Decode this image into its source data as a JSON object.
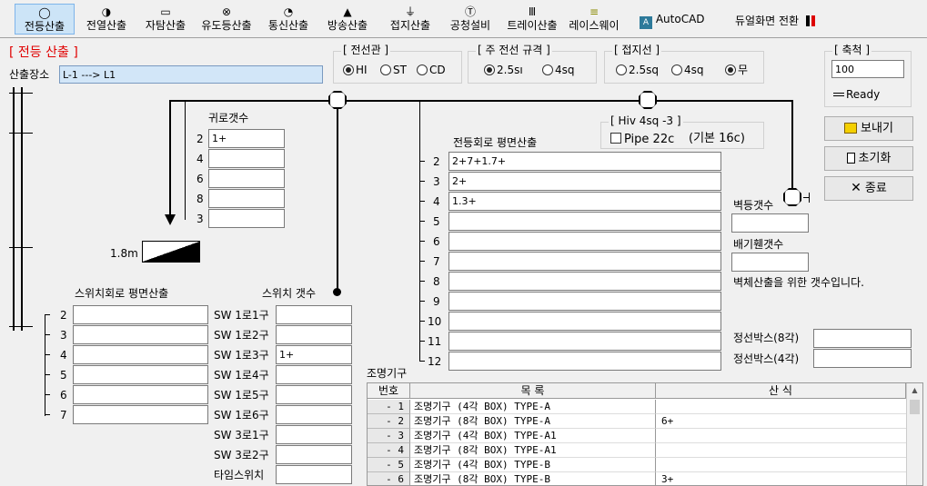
{
  "toolbar": {
    "tabs": [
      {
        "label": "전등산출",
        "icon": "◯"
      },
      {
        "label": "전열산출",
        "icon": "◑"
      },
      {
        "label": "자탐산출",
        "icon": "▭"
      },
      {
        "label": "유도등산출",
        "icon": "⊗"
      },
      {
        "label": "통신산출",
        "icon": "◔"
      },
      {
        "label": "방송산출",
        "icon": "▲"
      },
      {
        "label": "접지산출",
        "icon": "⏚"
      },
      {
        "label": "공청설비",
        "icon": "Ⓣ"
      },
      {
        "label": "트레이산출",
        "icon": "Ⅲ"
      },
      {
        "label": "레이스웨이",
        "icon": "≡"
      }
    ],
    "autocad_label": "AutoCAD",
    "dual_label": "듀얼화면 전환"
  },
  "section_title": "[ 전등 산출 ]",
  "location": {
    "label": "산출장소",
    "value": "L-1 ---> L1"
  },
  "wire_type": {
    "title": "[ 전선관 ]",
    "options": [
      "HI",
      "ST",
      "CD"
    ],
    "selected": "HI"
  },
  "main_wire": {
    "title": "[ 주 전선 규격 ]",
    "options": [
      "2.5sı",
      "4sq"
    ],
    "selected": "2.5sı"
  },
  "ground_wire": {
    "title": "[ 접지선 ]",
    "options": [
      "2.5sq",
      "4sq",
      "무"
    ],
    "selected": "무"
  },
  "scale": {
    "title": "[ 축척 ]",
    "value": "100",
    "status": "Ready"
  },
  "buttons": {
    "send": "보내기",
    "reset": "초기화",
    "exit": "종료"
  },
  "return_count": {
    "title": "귀로갯수",
    "rows": [
      {
        "n": "2",
        "value": "1+"
      },
      {
        "n": "4",
        "value": ""
      },
      {
        "n": "6",
        "value": ""
      },
      {
        "n": "8",
        "value": ""
      },
      {
        "n": "3",
        "value": ""
      }
    ]
  },
  "height_label": "1.8m",
  "hiv_box": {
    "title": "[ Hiv 4sq -3 ]",
    "pipe_label": "Pipe 22c",
    "default_label": "(기본 16c)"
  },
  "light_circuit": {
    "title": "전등회로 평면산출",
    "rows": [
      {
        "n": "2",
        "value": "2+7+1.7+"
      },
      {
        "n": "3",
        "value": "2+"
      },
      {
        "n": "4",
        "value": "1.3+"
      },
      {
        "n": "5",
        "value": ""
      },
      {
        "n": "6",
        "value": ""
      },
      {
        "n": "7",
        "value": ""
      },
      {
        "n": "8",
        "value": ""
      },
      {
        "n": "9",
        "value": ""
      },
      {
        "n": "10",
        "value": ""
      },
      {
        "n": "11",
        "value": ""
      },
      {
        "n": "12",
        "value": ""
      }
    ]
  },
  "wall_light": {
    "label": "벽등갯수",
    "value": ""
  },
  "exhaust_fan": {
    "label": "배기휀갯수",
    "value": ""
  },
  "wall_note": "벽체산출을 위한 갯수입니다.",
  "junction_8": {
    "label": "정선박스(8각)",
    "value": ""
  },
  "junction_4": {
    "label": "정선박스(4각)",
    "value": ""
  },
  "switch_circuit": {
    "title": "스위치회로 평면산출",
    "rows": [
      {
        "n": "2",
        "value": ""
      },
      {
        "n": "3",
        "value": ""
      },
      {
        "n": "4",
        "value": ""
      },
      {
        "n": "5",
        "value": ""
      },
      {
        "n": "6",
        "value": ""
      },
      {
        "n": "7",
        "value": ""
      }
    ]
  },
  "switch_count": {
    "title": "스위치 갯수",
    "rows": [
      {
        "label": "SW 1로1구",
        "value": ""
      },
      {
        "label": "SW 1로2구",
        "value": ""
      },
      {
        "label": "SW 1로3구",
        "value": "1+"
      },
      {
        "label": "SW 1로4구",
        "value": ""
      },
      {
        "label": "SW 1로5구",
        "value": ""
      },
      {
        "label": "SW 1로6구",
        "value": ""
      },
      {
        "label": "SW 3로1구",
        "value": ""
      },
      {
        "label": "SW 3로2구",
        "value": ""
      },
      {
        "label": "타임스위치",
        "value": ""
      }
    ]
  },
  "lamp_table": {
    "title": "조명기구",
    "headers": [
      "번호",
      "목           록",
      "산        식"
    ],
    "rows": [
      {
        "no": "- 1",
        "name": "조명기구 (4각 BOX) TYPE-A",
        "calc": ""
      },
      {
        "no": "- 2",
        "name": "조명기구 (8각 BOX) TYPE-A",
        "calc": "6+"
      },
      {
        "no": "- 3",
        "name": "조명기구 (4각 BOX) TYPE-A1",
        "calc": ""
      },
      {
        "no": "- 4",
        "name": "조명기구 (8각 BOX) TYPE-A1",
        "calc": ""
      },
      {
        "no": "- 5",
        "name": "조명기구 (4각 BOX) TYPE-B",
        "calc": ""
      },
      {
        "no": "- 6",
        "name": "조명기구 (8각 BOX) TYPE-B",
        "calc": "3+"
      }
    ]
  },
  "colors": {
    "title_red": "#e00000",
    "selected_tab": "#cce4f7",
    "location_bg": "#d2e6f8"
  }
}
